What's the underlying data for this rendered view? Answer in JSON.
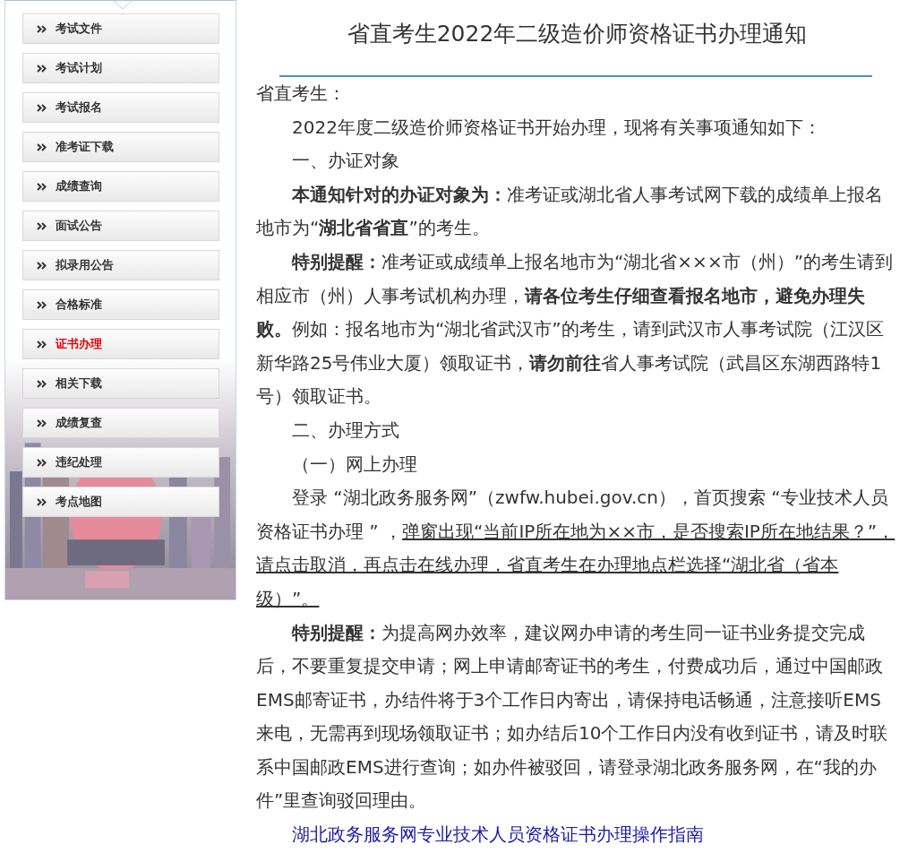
{
  "sidebar": {
    "items": [
      {
        "label": "考试文件",
        "selected": false
      },
      {
        "label": "考试计划",
        "selected": false
      },
      {
        "label": "考试报名",
        "selected": false
      },
      {
        "label": "准考证下载",
        "selected": false
      },
      {
        "label": "成绩查询",
        "selected": false
      },
      {
        "label": "面试公告",
        "selected": false
      },
      {
        "label": "拟录用公告",
        "selected": false
      },
      {
        "label": "合格标准",
        "selected": false
      },
      {
        "label": "证书办理",
        "selected": true
      },
      {
        "label": "相关下载",
        "selected": false
      },
      {
        "label": "成绩复查",
        "selected": false
      },
      {
        "label": "违纪处理",
        "selected": false
      },
      {
        "label": "考点地图",
        "selected": false
      }
    ]
  },
  "article": {
    "title": "省直考生2022年二级造价师资格证书办理通知",
    "paragraphs": [
      {
        "kind": "plain",
        "text": "省直考生："
      },
      {
        "kind": "indented",
        "text": "2022年度二级造价师资格证书开始办理，现将有关事项通知如下："
      },
      {
        "kind": "indented",
        "text": "一、办证对象"
      },
      {
        "kind": "indented",
        "text": "**本通知针对的办证对象为：**准考证或湖北省人事考试网下载的成绩单上报名地市为“**湖北省省直**”的考生。"
      },
      {
        "kind": "indented",
        "text": "**特别提醒：**准考证或成绩单上报名地市为“湖北省×××市（州）”的考生请到相应市（州）人事考试机构办理，**请各位考生仔细查看报名地市，避免办理失败。**例如：报名地市为“湖北省武汉市”的考生，请到武汉市人事考试院（江汉区新华路25号伟业大厦）领取证书，**请勿前往**省人事考试院（武昌区东湖西路特1号）领取证书。"
      },
      {
        "kind": "indented",
        "text": "二、办理方式"
      },
      {
        "kind": "indented",
        "text": "（一）网上办理"
      },
      {
        "kind": "indented",
        "text": "登录 “湖北政务服务网”（zwfw.hubei.gov.cn），首页搜索 “专业技术人员资格证书办理 ” ，",
        "underlined": "弹窗出现“当前IP所在地为××市，是否搜索IP所在地结果？”，请点击取消，再点击在线办理，省直考生在办理地点栏选择“湖北省（省本级）”。 "
      },
      {
        "kind": "indented",
        "text": "**特别提醒：**为提高网办效率，建议网办申请的考生同一证书业务提交完成后，不要重复提交申请；网上申请邮寄证书的考生，付费成功后，通过中国邮政EMS邮寄证书，办结件将于3个工作日内寄出，请保持电话畅通，注意接听EMS来电，无需再到现场领取证书；如办结后10个工作日内没有收到证书，请及时联系中国邮政EMS进行查询；如办件被驳回，请登录湖北政务服务网，在“我的办件”里查询驳回理由。"
      },
      {
        "kind": "link",
        "text": "湖北政务服务网专业技术人员资格证书办理操作指南"
      }
    ]
  }
}
